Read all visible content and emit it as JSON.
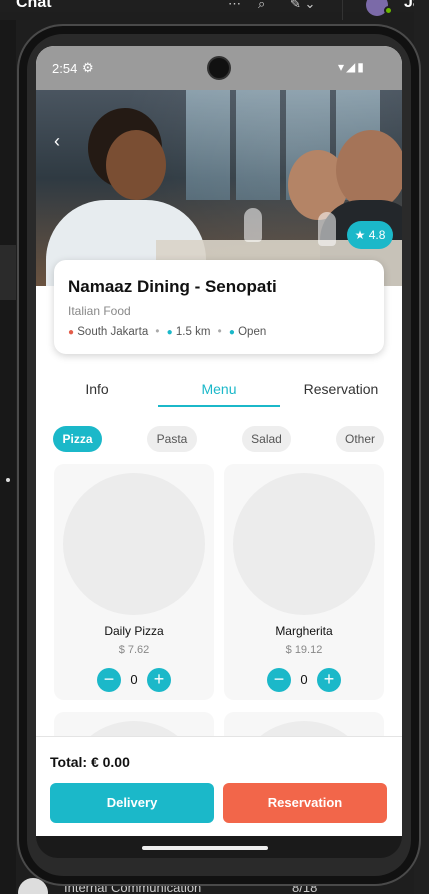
{
  "background": {
    "app_title": "Chat",
    "user_name": "Jai",
    "chat_preview": "Internal Communication",
    "chat_date": "8/18"
  },
  "status_bar": {
    "time": "2:54"
  },
  "restaurant": {
    "name": "Namaaz Dining - Senopati",
    "cuisine": "Italian Food",
    "rating": "4.8",
    "location": "South Jakarta",
    "distance": "1.5 km",
    "open_status": "Open"
  },
  "tabs": [
    {
      "label": "Info"
    },
    {
      "label": "Menu",
      "active": true
    },
    {
      "label": "Reservation"
    }
  ],
  "categories": [
    {
      "label": "Pizza",
      "active": true
    },
    {
      "label": "Pasta"
    },
    {
      "label": "Salad"
    },
    {
      "label": "Other"
    }
  ],
  "menu_items": [
    {
      "name": "Daily Pizza",
      "price": "$ 7.62",
      "qty": "0"
    },
    {
      "name": "Margherita",
      "price": "$ 19.12",
      "qty": "0"
    }
  ],
  "cart": {
    "total": "Total: € 0.00"
  },
  "actions": {
    "delivery": "Delivery",
    "reservation": "Reservation"
  },
  "colors": {
    "accent": "#1bb8c9",
    "reserve": "#f2664a"
  }
}
